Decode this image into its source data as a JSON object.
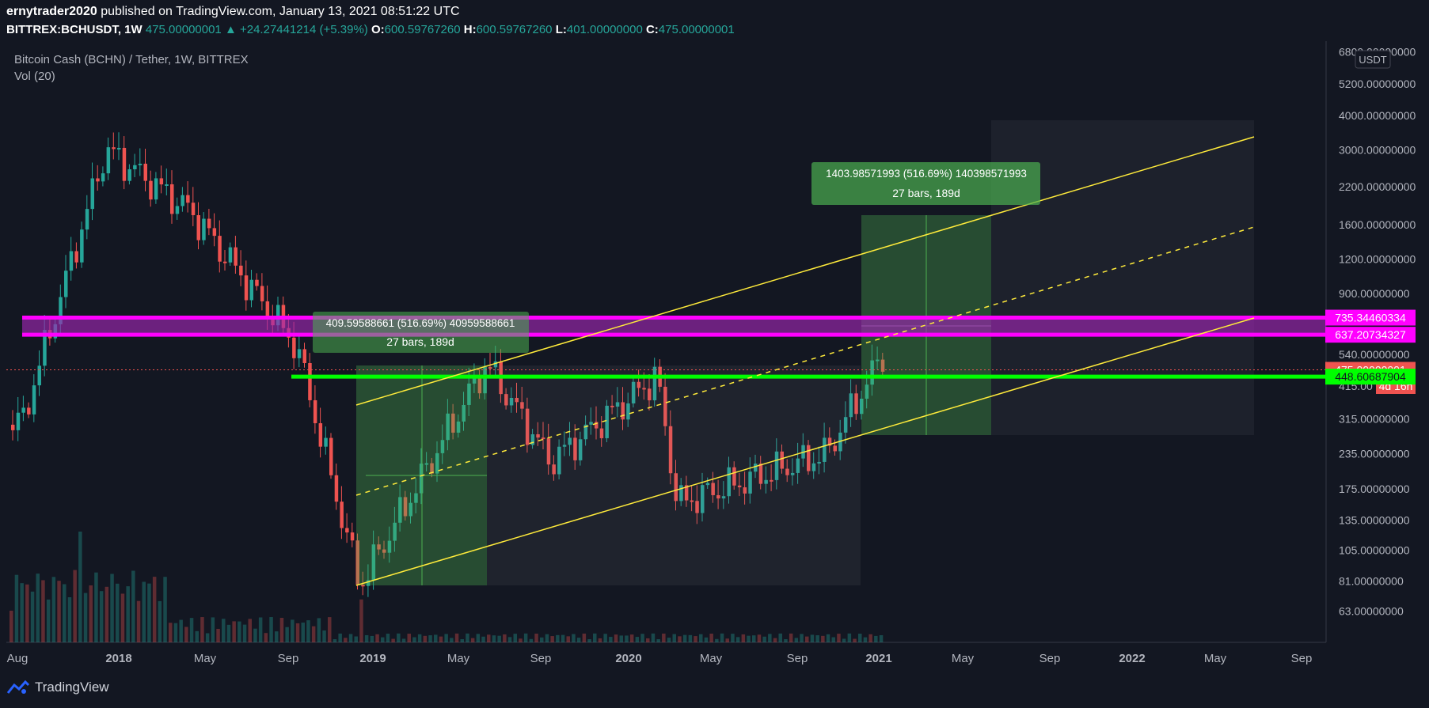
{
  "header": {
    "author": "ernytrader2020",
    "published_text": "published on TradingView.com, January 13, 2021 08:51:22 UTC",
    "symbol": "BITTREX:BCHUSDT, 1W",
    "last": "475.00000001",
    "change": "+24.27441214 (+5.39%)",
    "ohlc": [
      {
        "k": "O:",
        "v": "600.59767260"
      },
      {
        "k": "H:",
        "v": "600.59767260"
      },
      {
        "k": "L:",
        "v": "401.00000000"
      },
      {
        "k": "C:",
        "v": "475.00000001"
      }
    ]
  },
  "overlay": {
    "series_title": "Bitcoin Cash (BCHN) / Tether, 1W, BITTREX",
    "volume_label": "Vol (20)"
  },
  "footer": {
    "brand": "TradingView"
  },
  "colors": {
    "background": "#131722",
    "up": "#26a69a",
    "down": "#ef5350",
    "channel": "#ffeb3b",
    "zone": "#ff00ff",
    "support": "#00ff00",
    "measure": "#2e7d32"
  },
  "chart_data": {
    "type": "candlestick",
    "y_scale": "log",
    "currency_label": "USDT",
    "y_ticks": [
      "6800.00000000",
      "5200.00000000",
      "4000.00000000",
      "3000.00000000",
      "2200.00000000",
      "1600.00000000",
      "1200.00000000",
      "900.00000000",
      "540.00000000",
      "415.00",
      "315.00000000",
      "235.00000000",
      "175.00000000",
      "135.00000000",
      "105.00000000",
      "81.00000000",
      "63.00000000"
    ],
    "x_ticks": [
      "Aug",
      "2018",
      "May",
      "Sep",
      "2019",
      "May",
      "Sep",
      "2020",
      "May",
      "Sep",
      "2021",
      "May",
      "Sep",
      "2022",
      "May",
      "Sep"
    ],
    "price_labels": [
      {
        "text": "735.34460334",
        "value": 735.34460334,
        "color": "#ff00ff"
      },
      {
        "text": "637.20734327",
        "value": 637.20734327,
        "color": "#ff00ff"
      },
      {
        "text": "475.00000001",
        "value": 475.00000001,
        "color": "#ef5350"
      },
      {
        "text": "4d 16h",
        "value": 420,
        "color": "#ef5350"
      },
      {
        "text": "448.60687904",
        "value": 448.60687904,
        "color": "#00ff00"
      }
    ],
    "zone": {
      "from": 637.20734327,
      "to": 735.34460334
    },
    "support_level": 448.60687904,
    "projections": [
      {
        "line1": "409.59588661 (516.69%) 40959588661",
        "line2": "27 bars, 189d",
        "from": 77,
        "to": 476
      },
      {
        "line1": "1403.98571993 (516.69%) 140398571993",
        "line2": "27 bars, 189d",
        "from": 277,
        "to": 1680
      }
    ],
    "candles_anchor_prices": [
      {
        "date": "2017-08",
        "price": 300
      },
      {
        "date": "2017-12",
        "price": 3000
      },
      {
        "date": "2018-04",
        "price": 1800
      },
      {
        "date": "2018-09",
        "price": 580
      },
      {
        "date": "2018-12",
        "price": 78
      },
      {
        "date": "2019-06",
        "price": 500
      },
      {
        "date": "2019-09",
        "price": 220
      },
      {
        "date": "2020-02",
        "price": 450
      },
      {
        "date": "2020-03",
        "price": 155
      },
      {
        "date": "2020-10",
        "price": 235
      },
      {
        "date": "2021-01",
        "price": 600
      }
    ]
  }
}
